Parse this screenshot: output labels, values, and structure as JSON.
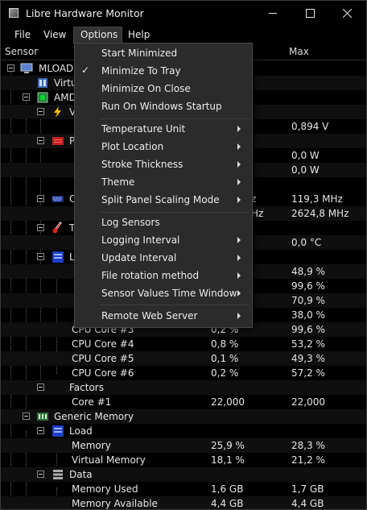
{
  "window": {
    "title": "Libre Hardware Monitor",
    "accent": "#2b2b2b"
  },
  "menubar": [
    {
      "label": "File"
    },
    {
      "label": "View"
    },
    {
      "label": "Options",
      "open": true
    },
    {
      "label": "Help"
    }
  ],
  "columns": {
    "sensor": "Sensor",
    "max": "Max"
  },
  "tree": [
    {
      "label": "MLOAD",
      "value": "",
      "max": ""
    },
    {
      "label": "Virtu",
      "value": "",
      "max": ""
    },
    {
      "label": "AMD",
      "value": "",
      "max": ""
    },
    {
      "label": "V",
      "value": "",
      "max": ""
    },
    {
      "label": "",
      "value": "",
      "max": "0,894 V"
    },
    {
      "label": "P",
      "value": "",
      "max": ""
    },
    {
      "label": "",
      "value": "",
      "max": "0,0 W"
    },
    {
      "label": "",
      "value": "",
      "max": "0,0 W"
    },
    {
      "label": "C",
      "value": "z",
      "max": "119,3 MHz"
    },
    {
      "label": "",
      "value": "Hz",
      "max": "2624,8 MHz"
    },
    {
      "label": "T",
      "value": "",
      "max": ""
    },
    {
      "label": "",
      "value": "",
      "max": "0,0 °C"
    },
    {
      "label": "L",
      "value": "",
      "max": ""
    },
    {
      "label": "",
      "value": "",
      "max": "48,9 %"
    },
    {
      "label": "",
      "value": "",
      "max": "99,6 %"
    },
    {
      "label": "",
      "value": "",
      "max": "70,9 %"
    },
    {
      "label": "",
      "value": "",
      "max": "38,0 %"
    },
    {
      "label": "CPU Core #3",
      "value": "0,2 %",
      "max": "99,6 %"
    },
    {
      "label": "CPU Core #4",
      "value": "0,8 %",
      "max": "53,2 %"
    },
    {
      "label": "CPU Core #5",
      "value": "0,1 %",
      "max": "49,3 %"
    },
    {
      "label": "CPU Core #6",
      "value": "0,2 %",
      "max": "57,2 %"
    },
    {
      "label": "Factors",
      "value": "",
      "max": ""
    },
    {
      "label": "Core #1",
      "value": "22,000",
      "max": "22,000"
    },
    {
      "label": "Generic Memory",
      "value": "",
      "max": ""
    },
    {
      "label": "Load",
      "value": "",
      "max": ""
    },
    {
      "label": "Memory",
      "value": "25,9 %",
      "max": "28,3 %"
    },
    {
      "label": "Virtual Memory",
      "value": "18,1 %",
      "max": "21,2 %"
    },
    {
      "label": "Data",
      "value": "",
      "max": ""
    },
    {
      "label": "Memory Used",
      "value": "1,6 GB",
      "max": "1,7 GB"
    },
    {
      "label": "Memory Available",
      "value": "4,4 GB",
      "max": "4,4 GB"
    }
  ],
  "options_menu": [
    {
      "label": "Start Minimized",
      "checked": false,
      "submenu": false
    },
    {
      "label": "Minimize To Tray",
      "checked": true,
      "submenu": false
    },
    {
      "label": "Minimize On Close",
      "checked": false,
      "submenu": false
    },
    {
      "label": "Run On Windows Startup",
      "checked": false,
      "submenu": false
    },
    {
      "label": "Temperature Unit",
      "checked": false,
      "submenu": true
    },
    {
      "label": "Plot Location",
      "checked": false,
      "submenu": true
    },
    {
      "label": "Stroke Thickness",
      "checked": false,
      "submenu": true
    },
    {
      "label": "Theme",
      "checked": false,
      "submenu": true
    },
    {
      "label": "Split Panel Scaling Mode",
      "checked": false,
      "submenu": true
    },
    {
      "label": "Log Sensors",
      "checked": false,
      "submenu": false
    },
    {
      "label": "Logging Interval",
      "checked": false,
      "submenu": true
    },
    {
      "label": "Update Interval",
      "checked": false,
      "submenu": true
    },
    {
      "label": "File rotation method",
      "checked": false,
      "submenu": true
    },
    {
      "label": "Sensor Values Time Window",
      "checked": false,
      "submenu": true
    },
    {
      "label": "Remote Web Server",
      "checked": false,
      "submenu": true
    }
  ],
  "check_glyph": "✓"
}
